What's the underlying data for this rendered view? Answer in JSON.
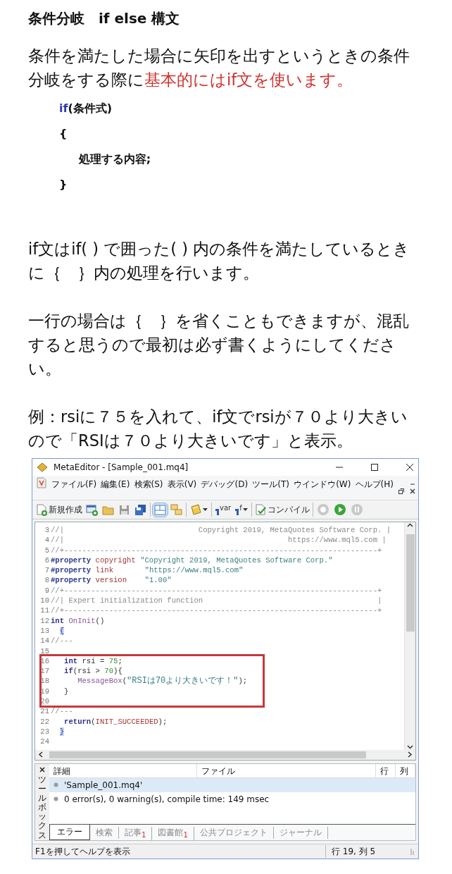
{
  "heading": "条件分岐　if else 構文",
  "intro": [
    {
      "text": "条件を満たした場合に矢印を出すというときの条件分岐をする際に",
      "emphasis": false
    },
    {
      "text": "基本的にはif文を使います。",
      "emphasis": true
    }
  ],
  "syntax_sample": [
    {
      "tokens": [
        {
          "kind": "keyword",
          "text": "if"
        },
        {
          "kind": "plain",
          "text": "(条件式)"
        }
      ]
    },
    {
      "tokens": [
        {
          "kind": "plain",
          "text": "{"
        }
      ]
    },
    {
      "tokens": [
        {
          "kind": "plain",
          "text": "     処理する内容;"
        }
      ]
    },
    {
      "tokens": [
        {
          "kind": "plain",
          "text": "}"
        }
      ]
    }
  ],
  "paragraphs": [
    "if文はif( ) で囲った( ) 内の条件を満たしているときに｛　｝内の処理を行います。",
    "一行の場合は｛　｝を省くこともできますが、混乱すると思うので最初は必ず書くようにしてください。",
    "例：rsiに７５を入れて、if文でrsiが７０より大きいので「RSIは７０より大きいです」と表示。"
  ],
  "editor": {
    "title": "MetaEditor - [Sample_001.mq4]",
    "menu": [
      "ファイル(F)",
      "編集(E)",
      "検索(S)",
      "表示(V)",
      "デバッグ(D)",
      "ツール(T)",
      "ウインドウ(W)",
      "ヘルプ(H)"
    ],
    "toolbar": [
      {
        "kind": "button",
        "label": "新規作成"
      },
      {
        "kind": "icon",
        "selected": false,
        "dropdown": false
      },
      {
        "kind": "icon",
        "selected": false,
        "dropdown": false
      },
      {
        "kind": "icon",
        "selected": false,
        "dropdown": false
      },
      {
        "kind": "icon",
        "selected": false,
        "dropdown": false
      },
      {
        "kind": "separator"
      },
      {
        "kind": "icon",
        "selected": true,
        "dropdown": false
      },
      {
        "kind": "icon",
        "selected": false,
        "dropdown": false
      },
      {
        "kind": "separator"
      },
      {
        "kind": "icon",
        "selected": false,
        "dropdown": true
      },
      {
        "kind": "separator"
      },
      {
        "kind": "icon",
        "label": "var",
        "selected": false,
        "dropdown": false
      },
      {
        "kind": "icon",
        "label": "f",
        "selected": false,
        "dropdown": true
      },
      {
        "kind": "separator"
      },
      {
        "kind": "button",
        "label": "コンパイル"
      },
      {
        "kind": "separator"
      },
      {
        "kind": "icon",
        "selected": false,
        "dropdown": false
      },
      {
        "kind": "icon",
        "selected": false,
        "dropdown": false
      },
      {
        "kind": "icon",
        "selected": false,
        "dropdown": false
      }
    ],
    "code_lines": [
      {
        "number": "3",
        "boxed": false,
        "tokens": [
          {
            "kind": "comment",
            "text": "//|                              Copyright 2019, MetaQuotes Software Corp. |"
          }
        ]
      },
      {
        "number": "4",
        "boxed": false,
        "tokens": [
          {
            "kind": "comment",
            "text": "//|                                                  https://www.mql5.com |"
          }
        ]
      },
      {
        "number": "5",
        "boxed": false,
        "tokens": [
          {
            "kind": "comment",
            "text": "//+----------------------------------------------------------------------+"
          }
        ]
      },
      {
        "number": "6",
        "boxed": false,
        "tokens": [
          {
            "kind": "directive",
            "text": "#property"
          },
          {
            "kind": "constant",
            "text": " copyright"
          },
          {
            "kind": "string",
            "text": " \"Copyright 2019, MetaQuotes Software Corp.\""
          }
        ]
      },
      {
        "number": "7",
        "boxed": false,
        "tokens": [
          {
            "kind": "directive",
            "text": "#property"
          },
          {
            "kind": "constant",
            "text": " link"
          },
          {
            "kind": "string",
            "text": "       \"https://www.mql5.com\""
          }
        ]
      },
      {
        "number": "8",
        "boxed": false,
        "tokens": [
          {
            "kind": "directive",
            "text": "#property"
          },
          {
            "kind": "constant",
            "text": " version"
          },
          {
            "kind": "string",
            "text": "    \"1.00\""
          }
        ]
      },
      {
        "number": "9",
        "boxed": false,
        "tokens": [
          {
            "kind": "comment",
            "text": "//+----------------------------------------------------------------------+"
          }
        ]
      },
      {
        "number": "10",
        "boxed": false,
        "tokens": [
          {
            "kind": "comment",
            "text": "//| Expert initialization function                                       |"
          }
        ]
      },
      {
        "number": "11",
        "boxed": false,
        "tokens": [
          {
            "kind": "comment",
            "text": "//+----------------------------------------------------------------------+"
          }
        ]
      },
      {
        "number": "12",
        "boxed": false,
        "tokens": [
          {
            "kind": "keyword",
            "text": "int"
          },
          {
            "kind": "function",
            "text": " OnInit"
          },
          {
            "kind": "plain",
            "text": "()"
          }
        ]
      },
      {
        "number": "13",
        "boxed": false,
        "tokens": [
          {
            "kind": "brace",
            "text": "  {"
          }
        ]
      },
      {
        "number": "14",
        "boxed": false,
        "tokens": [
          {
            "kind": "comment",
            "text": "//---"
          }
        ]
      },
      {
        "number": "15",
        "boxed": false
      },
      {
        "number": "16",
        "boxed": true,
        "tokens": [
          {
            "kind": "keyword",
            "text": "   int"
          },
          {
            "kind": "plain",
            "text": " rsi = "
          },
          {
            "kind": "number",
            "text": "75"
          },
          {
            "kind": "plain",
            "text": ";"
          }
        ]
      },
      {
        "number": "17",
        "boxed": true,
        "tokens": [
          {
            "kind": "keyword",
            "text": "   if"
          },
          {
            "kind": "plain",
            "text": "(rsi > "
          },
          {
            "kind": "number",
            "text": "70"
          },
          {
            "kind": "plain",
            "text": "){"
          }
        ]
      },
      {
        "number": "18",
        "boxed": true,
        "tokens": [
          {
            "kind": "function",
            "text": "      MessageBox"
          },
          {
            "kind": "plain",
            "text": "("
          },
          {
            "kind": "string",
            "text": "\"RSIは70より大きいです！\""
          },
          {
            "kind": "plain",
            "text": ");"
          }
        ]
      },
      {
        "number": "19",
        "boxed": true,
        "tokens": [
          {
            "kind": "plain",
            "text": "   }"
          }
        ]
      },
      {
        "number": "20",
        "boxed": true
      },
      {
        "number": "21",
        "boxed": false,
        "tokens": [
          {
            "kind": "comment",
            "text": "//---"
          }
        ]
      },
      {
        "number": "22",
        "boxed": false,
        "tokens": [
          {
            "kind": "keyword",
            "text": "   return"
          },
          {
            "kind": "plain",
            "text": "("
          },
          {
            "kind": "constant",
            "text": "INIT_SUCCEEDED"
          },
          {
            "kind": "plain",
            "text": ");"
          }
        ]
      },
      {
        "number": "23",
        "boxed": false,
        "tokens": [
          {
            "kind": "brace",
            "text": "  }"
          }
        ]
      },
      {
        "number": "24",
        "boxed": false
      }
    ],
    "toolbox": {
      "label": "ツールボックス",
      "columns": [
        "詳細",
        "ファイル",
        "行",
        "列"
      ],
      "rows": [
        {
          "detail": "'Sample_001.mq4'",
          "selected": true
        },
        {
          "detail": "0 error(s), 0 warning(s), compile time: 149 msec",
          "selected": false
        }
      ],
      "tabs": [
        {
          "label": "エラー",
          "selected": true
        },
        {
          "label": "検索",
          "selected": false
        },
        {
          "label": "記事",
          "badge": "1",
          "selected": false
        },
        {
          "label": "図書館",
          "badge": "1",
          "selected": false
        },
        {
          "label": "公共プロジェクト",
          "selected": false
        },
        {
          "label": "ジャーナル",
          "selected": false
        }
      ]
    },
    "status_bar": {
      "hint": "F1を押してヘルプを表示",
      "position": "行 19, 列 5"
    }
  }
}
